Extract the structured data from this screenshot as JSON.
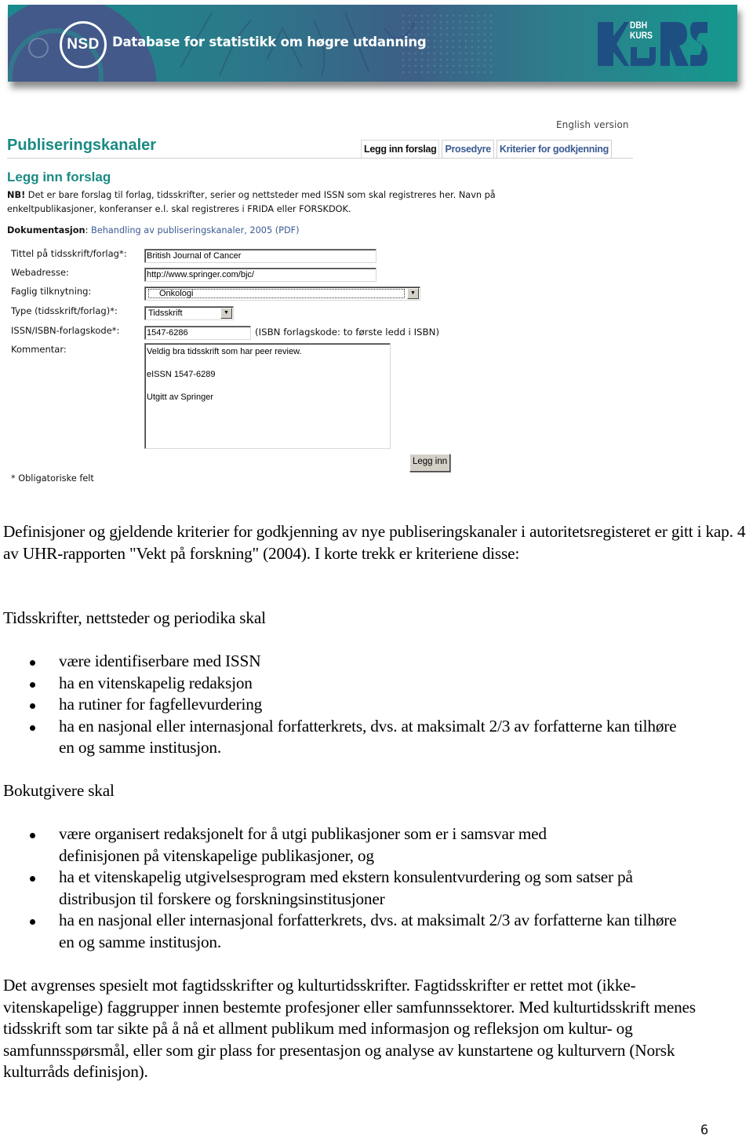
{
  "banner": {
    "logo_text": "NSD",
    "title": "Database for statistikk om høgre utdanning",
    "right_logo_text_line1": "DBH",
    "right_logo_text_line2": "KURS",
    "colors": {
      "teal": "#1a8a8c",
      "blue": "#3d5f86",
      "logo_blue": "#1e4f82"
    }
  },
  "web_form": {
    "english_link": "English version",
    "page_title": "Publiseringskanaler",
    "tabs": [
      {
        "label": "Legg inn forslag",
        "active": true
      },
      {
        "label": "Prosedyre",
        "active": false
      },
      {
        "label": "Kriterier for godkjenning",
        "active": false
      }
    ],
    "section_title": "Legg inn forslag",
    "nb_prefix": "NB!",
    "nb_text": " Det er bare forslag til forlag, tidsskrifter, serier og nettsteder med ISSN som skal registreres her. Navn på enkeltpublikasjoner, konferanser e.l. skal registreres i FRIDA eller FORSKDOK.",
    "documentation_label": "Dokumentasjon",
    "documentation_sep": ": ",
    "documentation_link": "Behandling av publiseringskanaler, 2005 (PDF)",
    "fields": {
      "title": {
        "label": "Tittel på tidsskrift/forlag*:",
        "value": "British Journal of Cancer"
      },
      "web": {
        "label": "Webadresse:",
        "value": "http://www.springer.com/bjc/"
      },
      "subject": {
        "label": "Faglig tilknytning:",
        "value": "Onkologi"
      },
      "type": {
        "label": "Type (tidsskrift/forlag)*:",
        "value": "Tidsskrift"
      },
      "issn": {
        "label": "ISSN/ISBN-forlagskode*:",
        "value": "1547-6286",
        "hint": "(ISBN forlagskode: to første ledd i ISBN)"
      },
      "comment": {
        "label": "Kommentar:",
        "value": "Veldig bra tidsskrift som har peer review.\n\neISSN 1547-6289\n\nUtgitt av Springer"
      }
    },
    "submit_label": "Legg inn",
    "mandatory_note": "* Obligatoriske felt",
    "accent_color": "#1a8a83",
    "link_color": "#3a5a92"
  },
  "document": {
    "intro": "Definisjoner og gjeldende kriterier for godkjenning av nye publiseringskanaler i autoritetsregisteret er gitt i kap. 4 av UHR-rapporten \"Vekt på forskning\" (2004). I korte trekk er kriteriene disse:",
    "journals_heading": "Tidsskrifter, nettsteder og periodika skal",
    "journal_criteria": [
      "være identifiserbare med ISSN",
      "ha en vitenskapelig redaksjon",
      "ha rutiner for fagfellevurdering",
      "ha en nasjonal eller internasjonal forfatterkrets, dvs. at maksimalt 2/3 av forfatterne kan tilhøre en og samme institusjon."
    ],
    "publishers_heading": "Bokutgivere skal",
    "publisher_criteria": [
      "være organisert redaksjonelt for å utgi publikasjoner som er i samsvar med definisjonen på vitenskapelige publikasjoner, og",
      "ha et vitenskapelig utgivelsesprogram med ekstern konsulentvurdering og som satser på distribusjon til forskere og forskningsinstitusjoner",
      "ha en nasjonal eller internasjonal forfatterkrets, dvs. at maksimalt 2/3 av forfatterne kan tilhøre en og samme institusjon."
    ],
    "closing": "Det avgrenses spesielt mot fagtidsskrifter og kulturtidsskrifter. Fagtidsskrifter er rettet mot (ikke-vitenskapelige) faggrupper innen bestemte profesjoner eller samfunnssektorer. Med kulturtidsskrift menes tidsskrift som tar sikte på å nå et allment publikum med informasjon og refleksjon om kultur- og samfunnsspørsmål, eller som gir plass for presentasjon og analyse av kunstartene og kulturvern (Norsk kulturråds definisjon).",
    "page_number": "6"
  }
}
